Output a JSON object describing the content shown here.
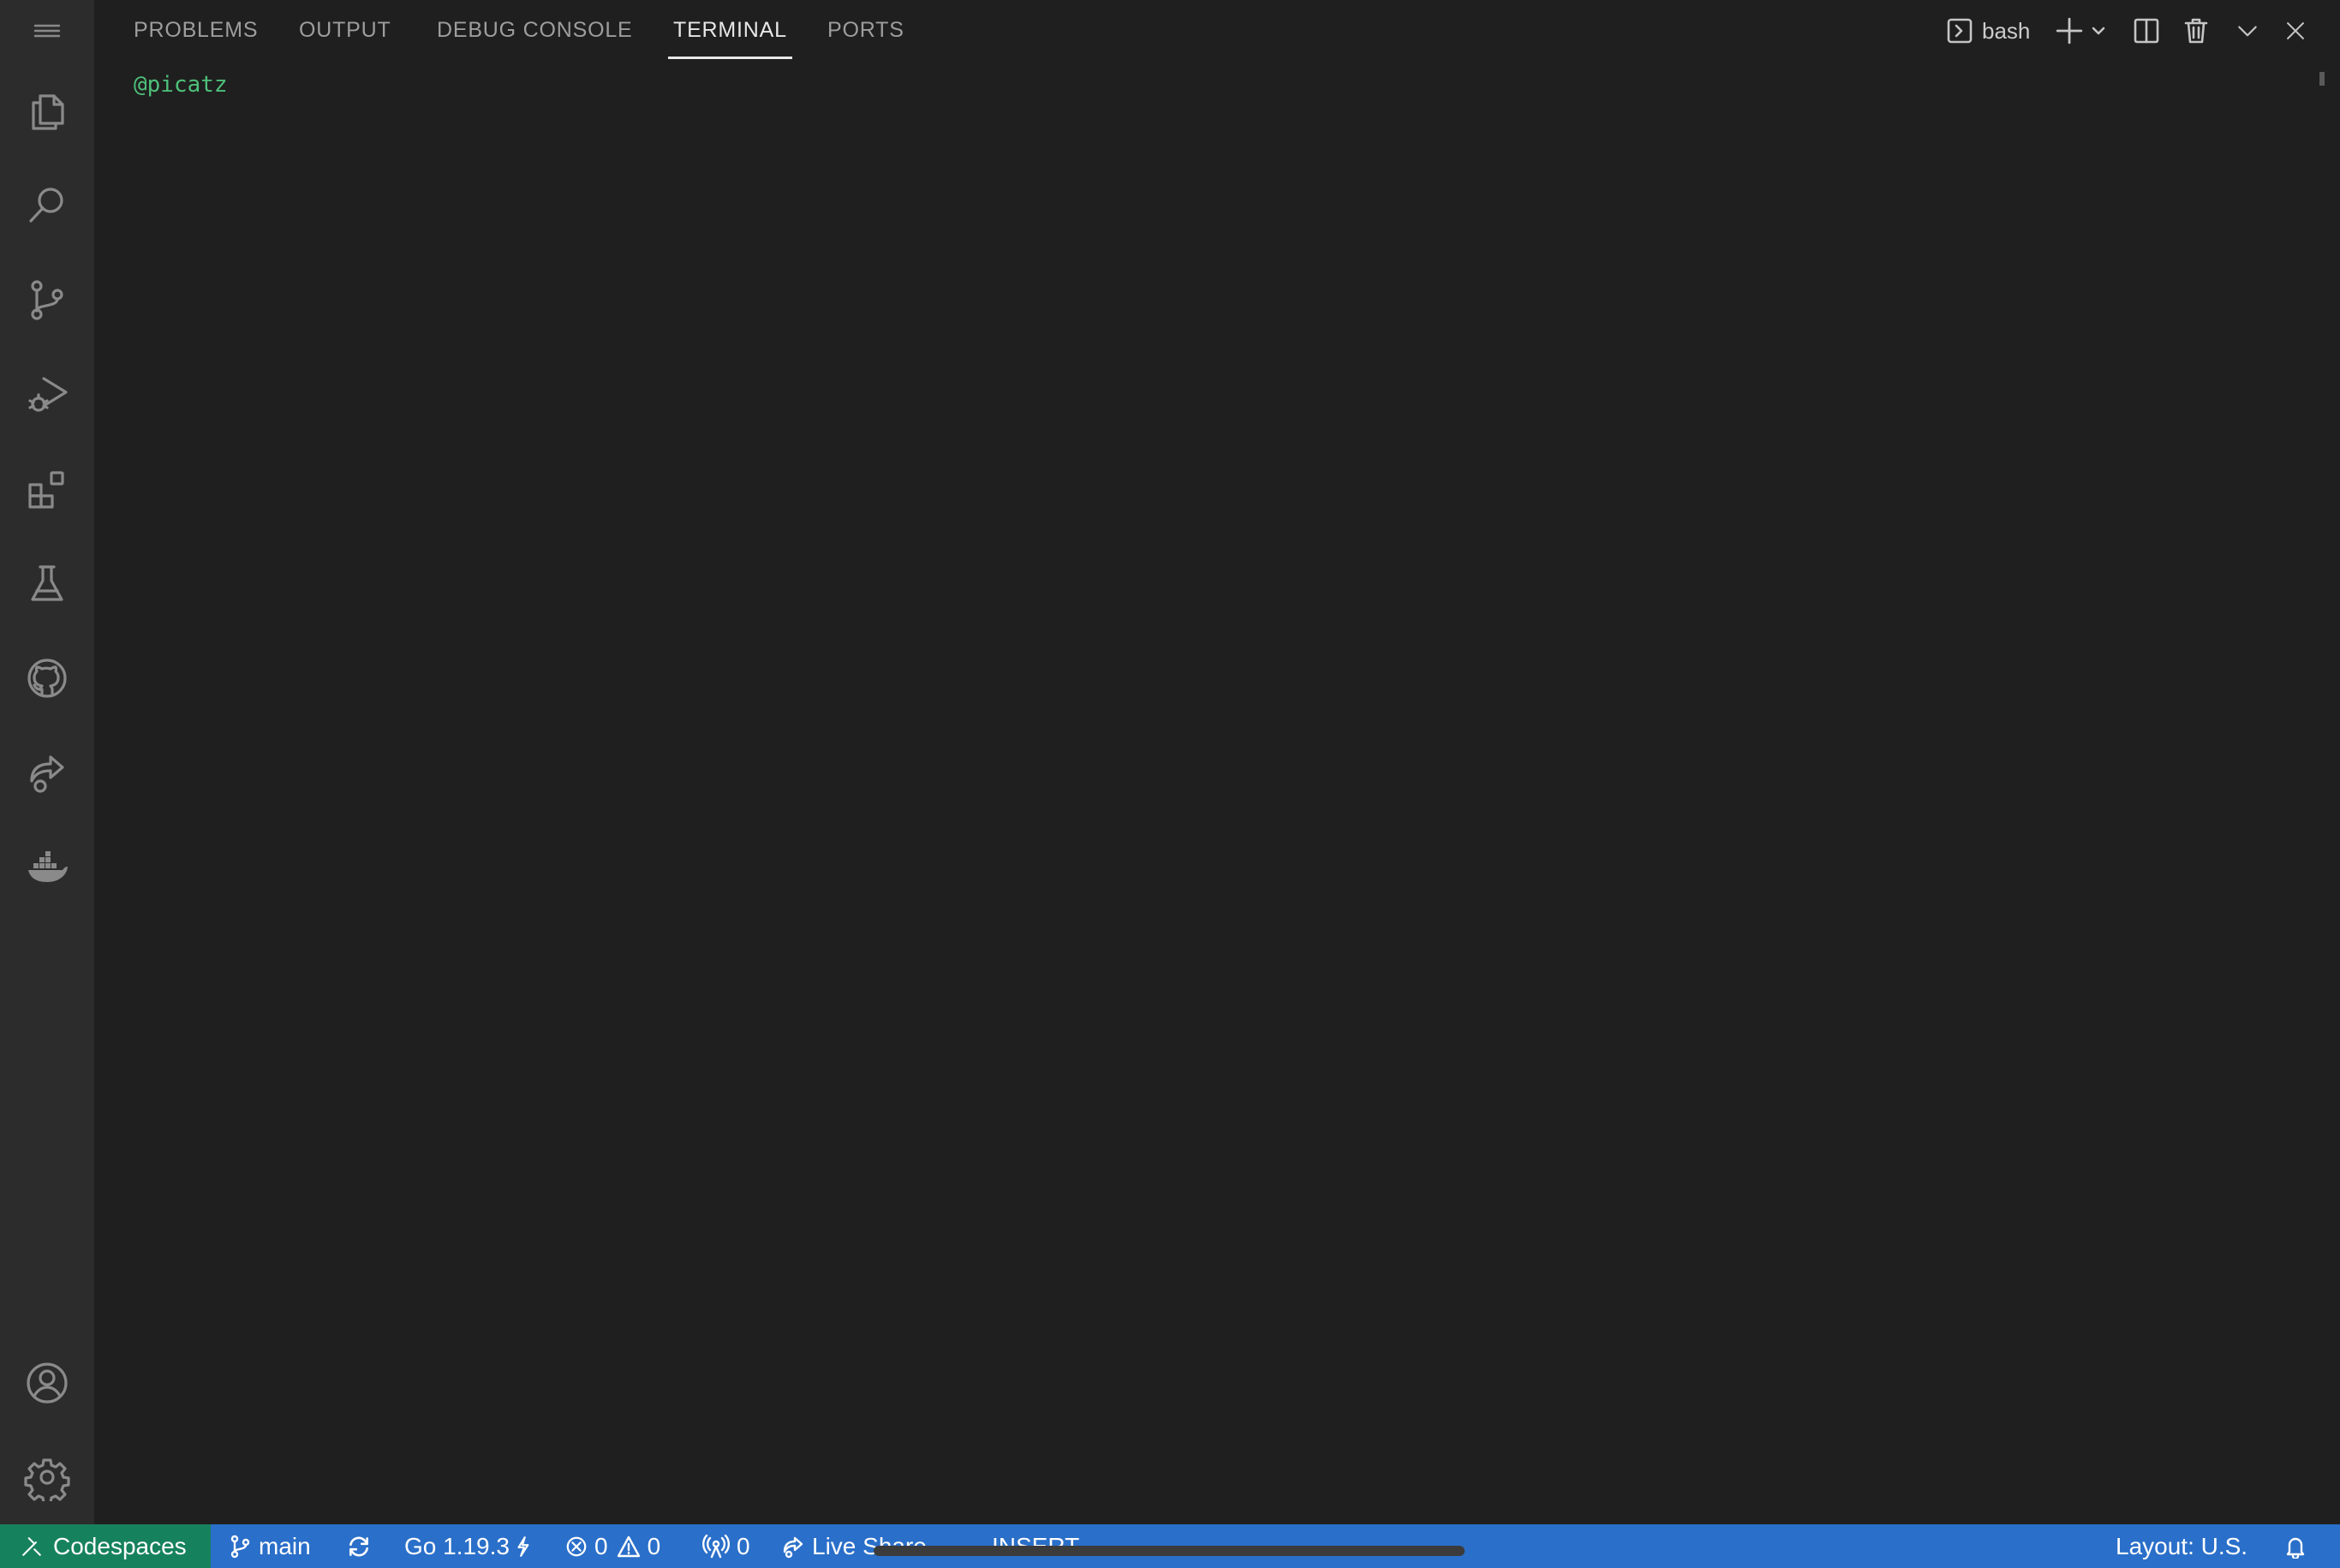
{
  "activity_bar": {
    "icons": [
      "menu-icon",
      "files-icon",
      "search-icon",
      "source-control-icon",
      "run-debug-icon",
      "extensions-icon",
      "testing-icon",
      "github-icon",
      "live-share-icon",
      "docker-icon",
      "account-icon",
      "settings-gear-icon"
    ]
  },
  "panel": {
    "tabs": [
      {
        "label": "PROBLEMS"
      },
      {
        "label": "OUTPUT"
      },
      {
        "label": "DEBUG CONSOLE"
      },
      {
        "label": "TERMINAL",
        "active": true
      },
      {
        "label": "PORTS"
      }
    ],
    "actions": {
      "shell_label": "bash"
    }
  },
  "terminal": {
    "prompt_user": "@picatz"
  },
  "status_bar": {
    "remote_label": "Codespaces",
    "branch": "main",
    "go_version": "Go 1.19.3",
    "errors": "0",
    "warnings": "0",
    "ports": "0",
    "live_share": "Live Share",
    "mode": "INSERT",
    "layout": "Layout: U.S."
  },
  "colors": {
    "status_bar": "#2a6fc9",
    "remote_indicator": "#16825d",
    "prompt_user": "#4ec07a",
    "background": "#1f1f1f",
    "activity_bar": "#2c2c2c"
  }
}
